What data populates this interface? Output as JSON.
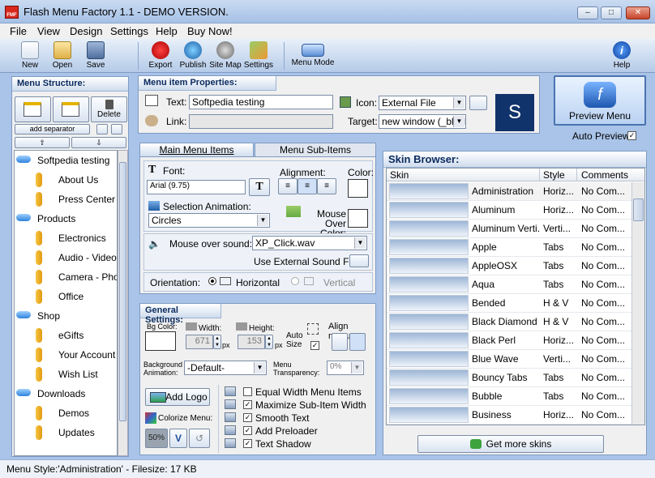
{
  "window": {
    "title": "Flash Menu Factory 1.1 - DEMO VERSION.",
    "app_icon_text": "FMF",
    "min": "–",
    "max": "□",
    "close": "✕"
  },
  "menu": [
    "File",
    "View",
    "Design",
    "Settings",
    "Help",
    "Buy Now!"
  ],
  "toolbar": {
    "new": "New",
    "open": "Open",
    "save": "Save",
    "export": "Export",
    "publish": "Publish",
    "sitemap": "Site Map",
    "settings": "Settings",
    "menu_mode": "Menu Mode",
    "help": "Help"
  },
  "menu_structure": {
    "title": "Menu Structure:",
    "delete": "Delete",
    "add_separator": "add separator",
    "items": [
      {
        "label": "Softpedia testing",
        "level": 0
      },
      {
        "label": "About Us",
        "level": 1
      },
      {
        "label": "Press Center",
        "level": 1
      },
      {
        "label": "Products",
        "level": 0
      },
      {
        "label": "Electronics",
        "level": 1
      },
      {
        "label": "Audio - Video",
        "level": 1
      },
      {
        "label": "Camera - Photo",
        "level": 1
      },
      {
        "label": "Office",
        "level": 1
      },
      {
        "label": "Shop",
        "level": 0
      },
      {
        "label": "eGifts",
        "level": 1
      },
      {
        "label": "Your Account",
        "level": 1
      },
      {
        "label": "Wish List",
        "level": 1
      },
      {
        "label": "Downloads",
        "level": 0
      },
      {
        "label": "Demos",
        "level": 1
      },
      {
        "label": "Updates",
        "level": 1
      }
    ]
  },
  "item_props": {
    "title": "Menu item Properties:",
    "text_label": "Text:",
    "text_value": "Softpedia testing",
    "link_label": "Link:",
    "icon_label": "Icon:",
    "icon_value": "External File",
    "target_label": "Target:",
    "target_value": "new window (_blank)",
    "icon_preview": "S"
  },
  "preview": {
    "button": "Preview Menu",
    "auto_preview": "Auto Preview",
    "auto_checked": "✓"
  },
  "tabs": {
    "main": "Main Menu Items",
    "sub": "Menu Sub-Items"
  },
  "font": {
    "font_label": "Font:",
    "font_value": "Arial (9.75)",
    "alignment_label": "Alignment:",
    "color_label": "Color:",
    "sel_anim_label": "Selection Animation:",
    "sel_anim_value": "Circles",
    "mouse_over_color": "Mouse Over Color:",
    "sound_label": "Mouse over sound:",
    "sound_value": "XP_Click.wav",
    "ext_sound_label": "Use External Sound File:",
    "orientation_label": "Orientation:",
    "horizontal": "Horizontal",
    "vertical": "Vertical"
  },
  "general": {
    "title": "General Settings:",
    "bgcolor": "Bg Color:",
    "width_label": "Width:",
    "width_value": "671",
    "height_label": "Height:",
    "height_value": "153",
    "px": "px",
    "px2": "px",
    "auto_size": "Auto Size",
    "align_menu": "Align menu:",
    "bg_anim_label": "Background Animation:",
    "bg_anim_value": "-Default-",
    "transparency_label": "Menu Transparency:",
    "transparency_value": "0%",
    "add_logo": "Add Logo",
    "colorize": "Colorize Menu:",
    "pct": "50%",
    "v": "V",
    "options": [
      {
        "label": "Equal Width Menu Items",
        "checked": ""
      },
      {
        "label": "Maximize Sub-Item Width",
        "checked": "✓"
      },
      {
        "label": "Smooth Text",
        "checked": "✓"
      },
      {
        "label": "Add Preloader",
        "checked": "✓"
      },
      {
        "label": "Text Shadow",
        "checked": "✓"
      }
    ]
  },
  "skins": {
    "title": "Skin Browser:",
    "col_skin": "Skin",
    "col_style": "Style",
    "col_comments": "Comments",
    "get_more": "Get more skins",
    "rows": [
      {
        "name": "Administration",
        "style": "Horiz...",
        "comments": "No Com..."
      },
      {
        "name": "Aluminum",
        "style": "Horiz...",
        "comments": "No Com..."
      },
      {
        "name": "Aluminum Verti...",
        "style": "Verti...",
        "comments": "No Com..."
      },
      {
        "name": "Apple",
        "style": "Tabs",
        "comments": "No Com..."
      },
      {
        "name": "AppleOSX",
        "style": "Tabs",
        "comments": "No Com..."
      },
      {
        "name": "Aqua",
        "style": "Tabs",
        "comments": "No Com..."
      },
      {
        "name": "Bended",
        "style": "H & V",
        "comments": "No Com..."
      },
      {
        "name": "Black Diamond",
        "style": "H & V",
        "comments": "No Com..."
      },
      {
        "name": "Black Perl",
        "style": "Horiz...",
        "comments": "No Com..."
      },
      {
        "name": "Blue Wave",
        "style": "Verti...",
        "comments": "No Com..."
      },
      {
        "name": "Bouncy Tabs",
        "style": "Tabs",
        "comments": "No Com..."
      },
      {
        "name": "Bubble",
        "style": "Tabs",
        "comments": "No Com..."
      },
      {
        "name": "Business",
        "style": "Horiz...",
        "comments": "No Com..."
      }
    ]
  },
  "status": "Menu Style:'Administration'  - Filesize: 17 KB",
  "colors": {
    "accent": "#0a2a5e",
    "panel_bg": "#f0f0f0",
    "frame": "#a9c4e8"
  },
  "icons": [
    "new-icon",
    "open-icon",
    "save-icon",
    "export-icon",
    "publish-icon",
    "sitemap-icon",
    "settings-icon",
    "menu-mode-icon",
    "help-icon"
  ]
}
